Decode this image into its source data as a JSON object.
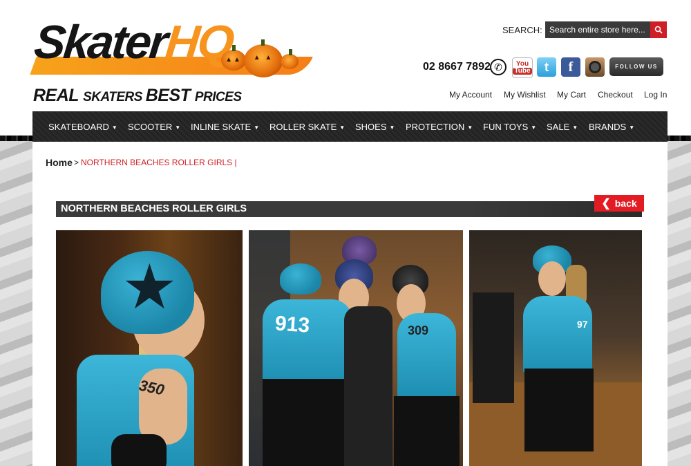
{
  "header": {
    "logo": {
      "word_main": "Skater",
      "word_accent": "HQ",
      "accent_color": "#f7941d"
    },
    "tagline": {
      "part1": "REAL ",
      "part2": "SKATERS ",
      "part3": "BEST ",
      "part4": "PRICES"
    },
    "search": {
      "label": "SEARCH:",
      "placeholder": "Search entire store here..."
    },
    "phone": "02 8667 7892",
    "social": {
      "youtube_top": "You",
      "youtube_bottom": "Tube",
      "twitter": "t",
      "facebook": "f",
      "follow": "FOLLOW US"
    },
    "account_links": [
      "My Account",
      "My Wishlist",
      "My Cart",
      "Checkout",
      "Log In"
    ]
  },
  "nav": {
    "items": [
      "SKATEBOARD",
      "SCOOTER",
      "INLINE SKATE",
      "ROLLER SKATE",
      "SHOES",
      "PROTECTION",
      "FUN TOYS",
      "SALE",
      "BRANDS"
    ],
    "arrow": "▼"
  },
  "breadcrumb": {
    "home": "Home",
    "separator": ">",
    "current": "NORTHERN BEACHES ROLLER GIRLS |"
  },
  "page": {
    "title": "NORTHERN BEACHES ROLLER GIRLS",
    "back_label": "back",
    "back_chevron": "❮"
  },
  "photos": {
    "p1_number": "350",
    "p2_number": "913",
    "p2_number2": "309",
    "p3_number": "97"
  },
  "colors": {
    "brand_orange": "#f7941d",
    "brand_red": "#cf1e25",
    "nav_bg": "#2a2a2a"
  }
}
